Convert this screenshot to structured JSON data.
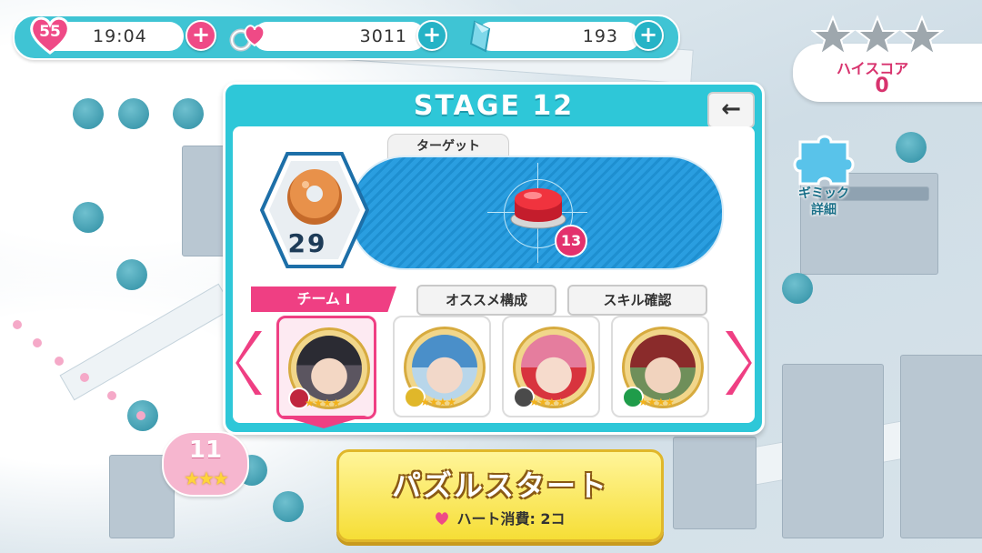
{
  "resources": {
    "hearts": {
      "count": "55",
      "timer": "19:04",
      "icon": "heart-icon"
    },
    "rings": {
      "value": "3011",
      "icon": "rings-icon"
    },
    "crystals": {
      "value": "193",
      "icon": "crystal-icon"
    },
    "plus_label": "+"
  },
  "high_score": {
    "label": "ハイスコア",
    "value": "0",
    "stars_earned": 0,
    "stars_total": 3
  },
  "gimmick": {
    "label": "ギミック\n詳細",
    "icon": "puzzle-piece-icon"
  },
  "stage": {
    "title": "STAGE 12",
    "back_label": "←",
    "moves": "29",
    "moves_icon": "donut-icon",
    "target_label": "ターゲット",
    "target_icon": "red-button-icon",
    "target_count": "13"
  },
  "team": {
    "tab_label": "チーム I",
    "recommend_label": "オススメ構成",
    "skill_label": "スキル確認",
    "members": [
      {
        "name": "member-1",
        "hair": "#2b2b33",
        "skin": "#f3d7c4",
        "badge": "crown",
        "badge_color": "#c0263e"
      },
      {
        "name": "member-2",
        "hair": "#4a8fc9",
        "skin": "#f2d8c9",
        "badge": "mortarboard",
        "badge_color": "#e0b72a"
      },
      {
        "name": "member-3",
        "hair": "#e57d9e",
        "skin": "#f6dbcc",
        "badge": "mortarboard",
        "badge_color": "#4a4a4a"
      },
      {
        "name": "member-4",
        "hair": "#8a2b2b",
        "skin": "#f1d3be",
        "badge": "flag",
        "badge_color": "#1f9c4a"
      }
    ],
    "stars": "★★★★"
  },
  "previous_stage": {
    "number": "11",
    "stars": "★★★"
  },
  "start_button": {
    "label": "パズルスタート",
    "cost_label": "ハート消費: 2コ"
  },
  "colors": {
    "accent_teal": "#2ec7d8",
    "accent_pink": "#ef3f83",
    "start_yellow": "#f6de36"
  }
}
